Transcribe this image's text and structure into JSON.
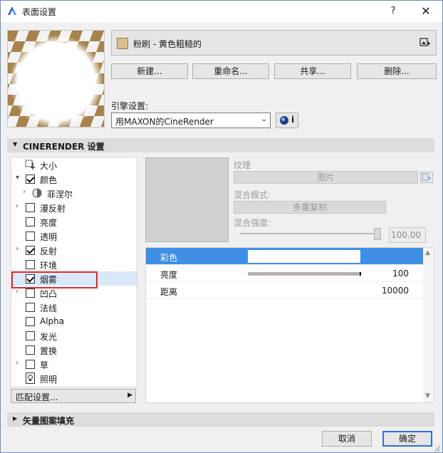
{
  "window": {
    "title": "表面设置",
    "help_glyph": "?",
    "close_glyph": "✕"
  },
  "material": {
    "name": "粉刷 - 黄色粗糙的",
    "swatch_color": "#d8c08a"
  },
  "buttons": {
    "new": "新建...",
    "rename": "重命名...",
    "share": "共享...",
    "delete": "删除..."
  },
  "engine": {
    "label": "引擎设置:",
    "selected": "用MAXON的CineRender",
    "info_glyph": "i"
  },
  "sections": {
    "cinerender": "CINERENDER 设置",
    "vector_fill": "矢量图案填充"
  },
  "channels": [
    {
      "label": "大小",
      "expand": "",
      "check": "size"
    },
    {
      "label": "颜色",
      "expand": "▾",
      "check": "checked"
    },
    {
      "label": "菲涅尔",
      "expand": "›",
      "check": "radio"
    },
    {
      "label": "漫反射",
      "expand": "›",
      "check": "unchecked"
    },
    {
      "label": "亮度",
      "expand": "",
      "check": "unchecked"
    },
    {
      "label": "透明",
      "expand": "",
      "check": "unchecked"
    },
    {
      "label": "反射",
      "expand": "›",
      "check": "checked"
    },
    {
      "label": "环境",
      "expand": "",
      "check": "unchecked"
    },
    {
      "label": "烟雾",
      "expand": "",
      "check": "checked"
    },
    {
      "label": "凹凸",
      "expand": "›",
      "check": "unchecked"
    },
    {
      "label": "法线",
      "expand": "",
      "check": "unchecked"
    },
    {
      "label": "Alpha",
      "expand": "",
      "check": "unchecked"
    },
    {
      "label": "发光",
      "expand": "",
      "check": "unchecked"
    },
    {
      "label": "置换",
      "expand": "",
      "check": "unchecked"
    },
    {
      "label": "草",
      "expand": "›",
      "check": "unchecked"
    },
    {
      "label": "照明",
      "expand": "",
      "check": "light"
    }
  ],
  "match_settings": "匹配设置...",
  "texture": {
    "label": "纹理",
    "image_button": "图片",
    "blend_mode_label": "混合模式:",
    "blend_mode_value": "多重复制",
    "blend_strength_label": "混合强度:",
    "blend_strength_value": "100.00"
  },
  "properties": [
    {
      "name": "彩色",
      "value": ""
    },
    {
      "name": "亮度",
      "value": "100"
    },
    {
      "name": "距离",
      "value": "10000"
    }
  ],
  "footer": {
    "cancel": "取消",
    "ok": "确定"
  }
}
